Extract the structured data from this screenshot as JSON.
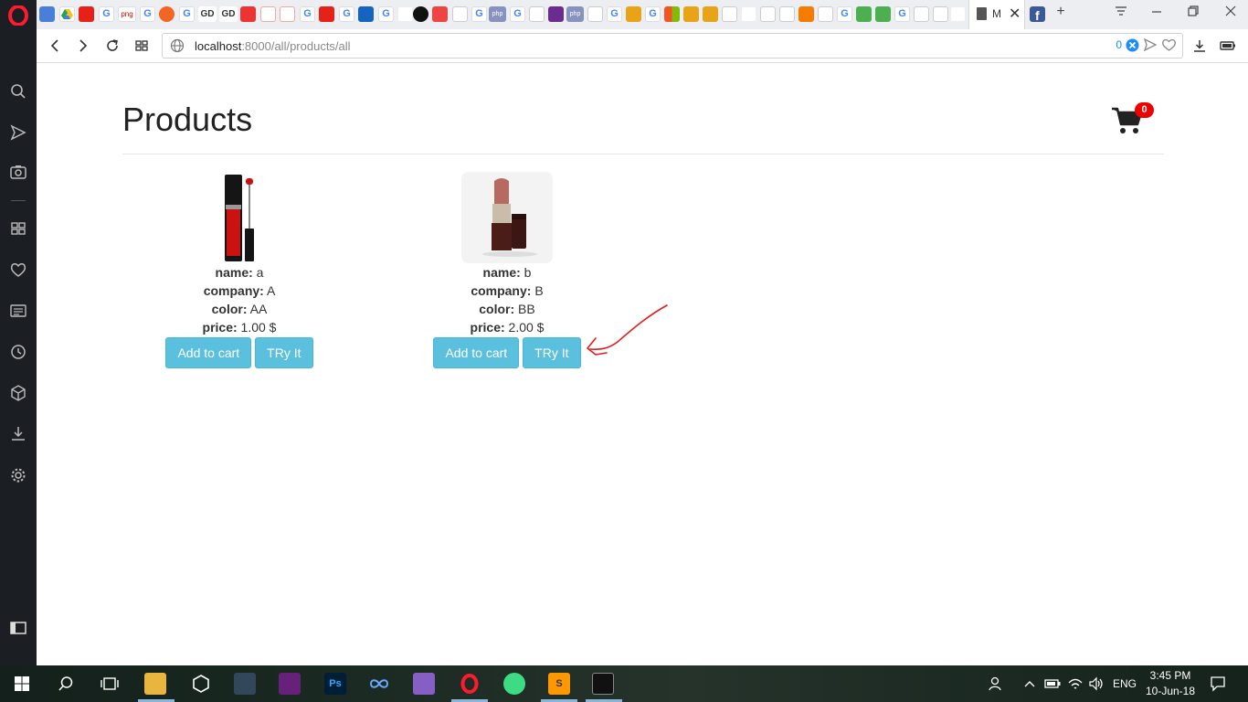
{
  "browser": {
    "active_tab_title": "M",
    "url_host": "localhost",
    "url_path": ":8000/all/products/all",
    "adblock_count": "0"
  },
  "page": {
    "title": "Products",
    "cart_count": "0"
  },
  "field_labels": {
    "name": "name:",
    "company": "company:",
    "color": "color:",
    "price": "price:"
  },
  "products": [
    {
      "name": "a",
      "company": "A",
      "color": "AA",
      "price": "1.00 $",
      "add_label": "Add to cart",
      "try_label": "TRy It",
      "image": "lip-gloss-image"
    },
    {
      "name": "b",
      "company": "B",
      "color": "BB",
      "price": "2.00 $",
      "add_label": "Add to cart",
      "try_label": "TRy It",
      "image": "lipstick-image"
    }
  ],
  "taskbar": {
    "lang": "ENG",
    "time": "3:45 PM",
    "date": "10-Jun-18"
  },
  "favicon_labels": [
    "png",
    "GD",
    "GD",
    "php",
    "php"
  ],
  "colors": {
    "primary_button": "#5bc0de",
    "badge": "#ee0000",
    "sidebar": "#1b1e22",
    "annotation_arrow": "#e31b1b"
  }
}
